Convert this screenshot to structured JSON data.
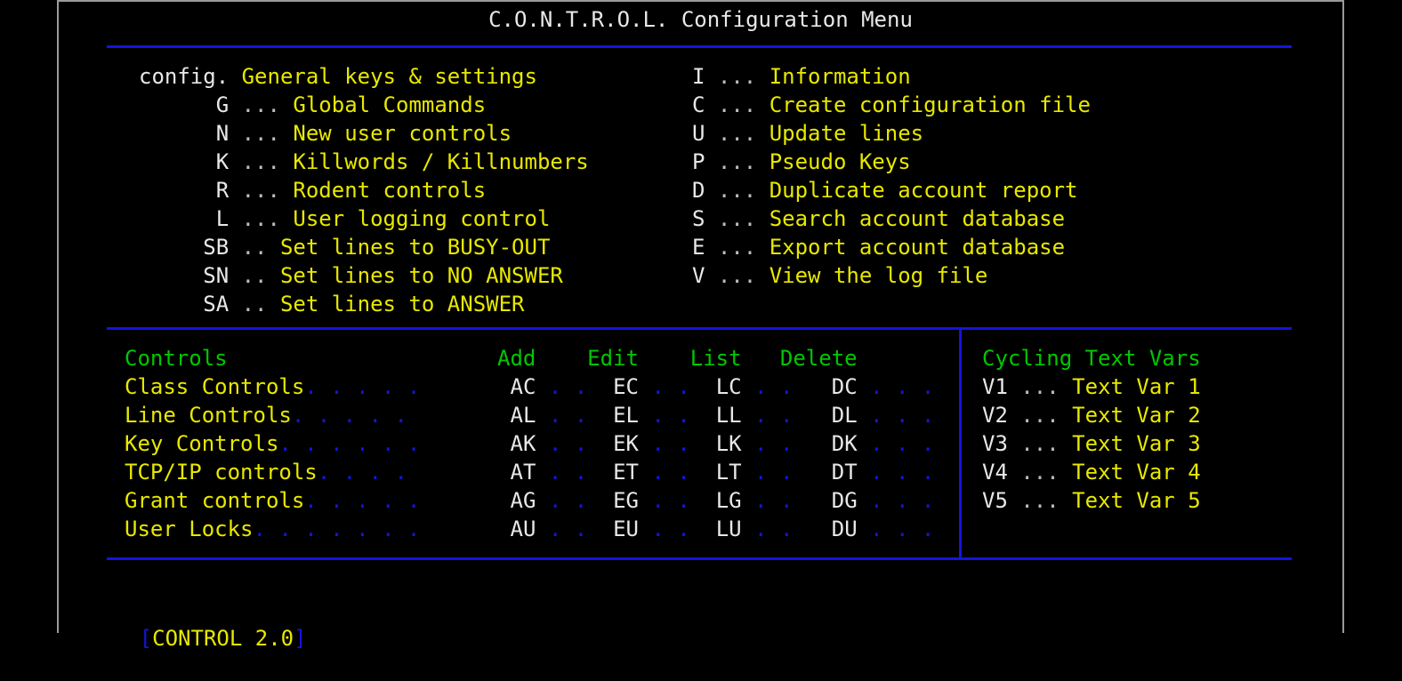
{
  "window": {
    "title": "C.O.N.T.R.O.L. Configuration Menu",
    "frame_color": "#9a9a9a",
    "background": "#000000",
    "rule_color": "#1414e0",
    "key_color": "#e8e8e8",
    "label_color": "#e8e800",
    "header_color": "#00c800"
  },
  "main_menu": {
    "left_column": [
      {
        "key": "config.",
        "sep": " ",
        "label": "General keys & settings"
      },
      {
        "key": "G",
        "sep": " ... ",
        "label": "Global Commands"
      },
      {
        "key": "N",
        "sep": " ... ",
        "label": "New user controls"
      },
      {
        "key": "K",
        "sep": " ... ",
        "label": "Killwords / Killnumbers"
      },
      {
        "key": "R",
        "sep": " ... ",
        "label": "Rodent controls"
      },
      {
        "key": "L",
        "sep": " ... ",
        "label": "User logging control"
      },
      {
        "key": "SB",
        "sep": " .. ",
        "label": "Set lines to BUSY-OUT"
      },
      {
        "key": "SN",
        "sep": " .. ",
        "label": "Set lines to NO ANSWER"
      },
      {
        "key": "SA",
        "sep": " .. ",
        "label": "Set lines to ANSWER"
      }
    ],
    "right_column": [
      {
        "key": "I",
        "sep": " ... ",
        "label": "Information"
      },
      {
        "key": "C",
        "sep": " ... ",
        "label": "Create configuration file"
      },
      {
        "key": "U",
        "sep": " ... ",
        "label": "Update lines"
      },
      {
        "key": "P",
        "sep": " ... ",
        "label": "Pseudo Keys"
      },
      {
        "key": "D",
        "sep": " ... ",
        "label": "Duplicate account report"
      },
      {
        "key": "S",
        "sep": " ... ",
        "label": "Search account database"
      },
      {
        "key": "E",
        "sep": " ... ",
        "label": "Export account database"
      },
      {
        "key": "V",
        "sep": " ... ",
        "label": "View the log file"
      }
    ]
  },
  "controls_panel": {
    "headers": {
      "name": "Controls",
      "add": "Add",
      "edit": "Edit",
      "list": "List",
      "delete": "Delete"
    },
    "rows": [
      {
        "name": "Class Controls",
        "add": "AC",
        "edit": "EC",
        "list": "LC",
        "delete": "DC"
      },
      {
        "name": "Line Controls",
        "add": "AL",
        "edit": "EL",
        "list": "LL",
        "delete": "DL"
      },
      {
        "name": "Key Controls",
        "add": "AK",
        "edit": "EK",
        "list": "LK",
        "delete": "DK"
      },
      {
        "name": "TCP/IP controls",
        "add": "AT",
        "edit": "ET",
        "list": "LT",
        "delete": "DT"
      },
      {
        "name": "Grant controls",
        "add": "AG",
        "edit": "EG",
        "list": "LG",
        "delete": "DG"
      },
      {
        "name": "User Locks",
        "add": "AU",
        "edit": "EU",
        "list": "LU",
        "delete": "DU"
      }
    ]
  },
  "cycling_text_vars": {
    "header": "Cycling Text Vars",
    "items": [
      {
        "key": "V1",
        "sep": " ... ",
        "label": "Text Var 1"
      },
      {
        "key": "V2",
        "sep": " ... ",
        "label": "Text Var 2"
      },
      {
        "key": "V3",
        "sep": " ... ",
        "label": "Text Var 3"
      },
      {
        "key": "V4",
        "sep": " ... ",
        "label": "Text Var 4"
      },
      {
        "key": "V5",
        "sep": " ... ",
        "label": "Text Var 5"
      }
    ]
  },
  "footer": {
    "bracket_open": "[",
    "text": "CONTROL 2.0",
    "bracket_close": "]"
  }
}
